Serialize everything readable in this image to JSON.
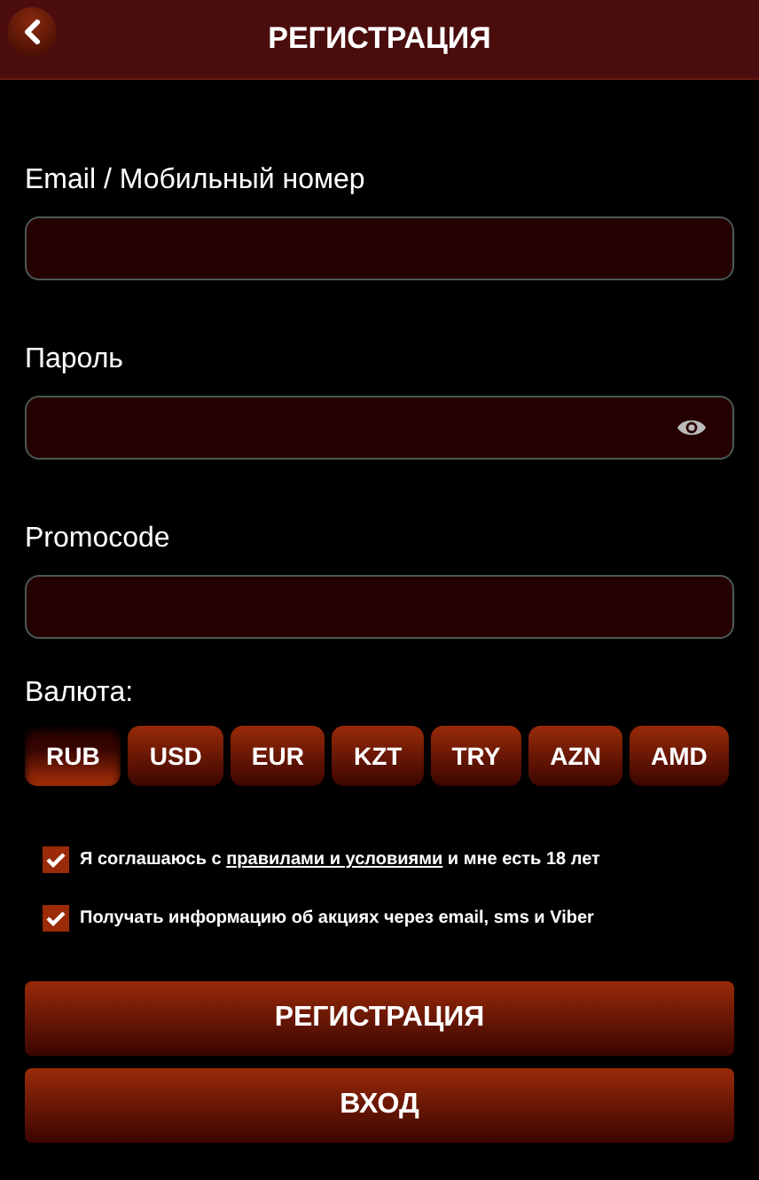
{
  "header": {
    "title": "РЕГИСТРАЦИЯ"
  },
  "fields": [
    {
      "label": "Email / Мобильный номер",
      "kind": "text"
    },
    {
      "label": "Пароль",
      "kind": "password"
    },
    {
      "label": "Promocode",
      "kind": "text"
    }
  ],
  "currency": {
    "label": "Валюта:",
    "options": [
      {
        "code": "RUB",
        "selected": true
      },
      {
        "code": "USD",
        "selected": false
      },
      {
        "code": "EUR",
        "selected": false
      },
      {
        "code": "KZT",
        "selected": false
      },
      {
        "code": "TRY",
        "selected": false
      },
      {
        "code": "AZN",
        "selected": false
      },
      {
        "code": "AMD",
        "selected": false
      }
    ]
  },
  "agreements": [
    {
      "checked": true,
      "text_before": "Я соглашаюсь с ",
      "link": "правилами и условиями",
      "text_after": " и мне есть 18 лет"
    },
    {
      "checked": true,
      "text_before": "Получать информацию об акциях через email, sms и Viber"
    }
  ],
  "buttons": [
    "РЕГИСТРАЦИЯ",
    "ВХОД"
  ]
}
